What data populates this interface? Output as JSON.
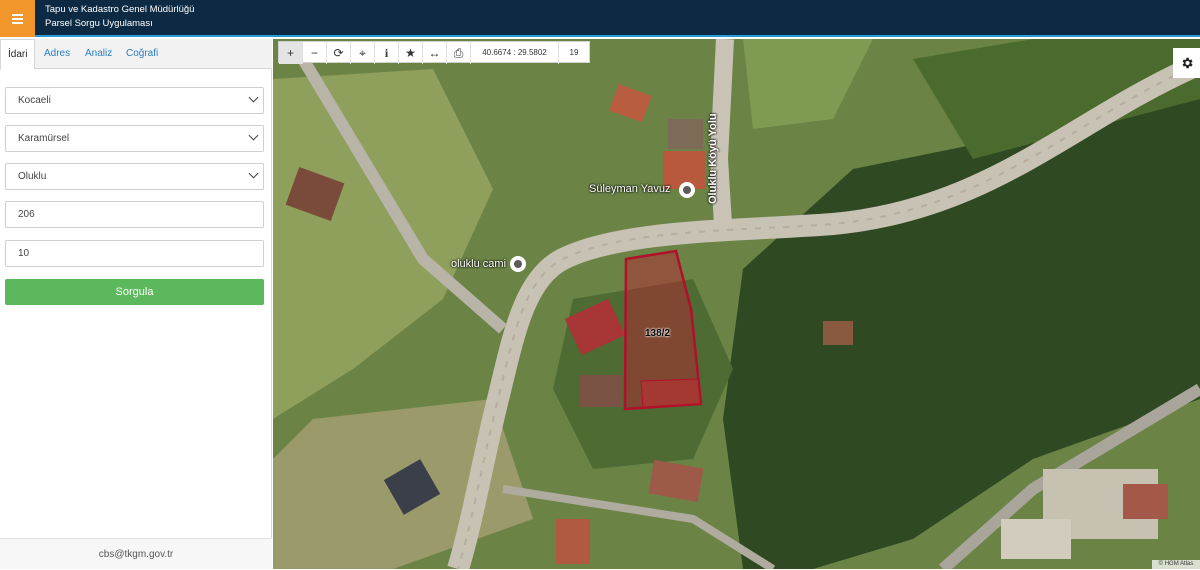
{
  "header": {
    "title_line1": "Tapu ve Kadastro Genel Müdürlüğü",
    "title_line2": "Parsel Sorgu Uygulaması",
    "menu_icon": "hamburger-icon"
  },
  "sidebar": {
    "tabs": [
      {
        "label": "İdari",
        "active": true
      },
      {
        "label": "Adres",
        "active": false
      },
      {
        "label": "Analiz",
        "active": false
      },
      {
        "label": "Coğrafi",
        "active": false
      }
    ],
    "province": "Kocaeli",
    "district": "Karamürsel",
    "neighborhood": "Oluklu",
    "block": "206",
    "parcel": "10",
    "query_button": "Sorgula",
    "footer_email": "cbs@tkgm.gov.tr"
  },
  "toolbar": {
    "icons": [
      "zoom-in-icon",
      "zoom-out-icon",
      "refresh-icon",
      "locate-icon",
      "info-icon",
      "star-icon",
      "measure-icon",
      "print-icon"
    ],
    "coordinates": "40.6674 : 29.5802",
    "zoom_level": "19"
  },
  "map": {
    "labels": {
      "person": "Süleyman Yavuz",
      "mosque": "oluklu cami",
      "road": "Oluklu Köyü Yolu",
      "parcel": "138/2"
    },
    "attribution": "© HGM Atlas",
    "parcel_color": "#b0102a",
    "accent_color": "#f0962a"
  }
}
